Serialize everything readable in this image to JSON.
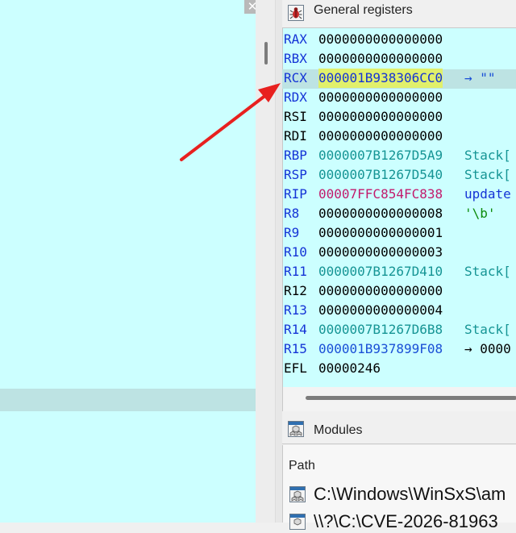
{
  "left_pane": {
    "close_glyph": "✕"
  },
  "registers_panel": {
    "title": "General registers",
    "rows": [
      {
        "name": "RAX",
        "value": "0000000000000000",
        "info": ""
      },
      {
        "name": "RBX",
        "value": "0000000000000000",
        "info": ""
      },
      {
        "name": "RCX",
        "value": "000001B938306CC0",
        "info": "→ \"\""
      },
      {
        "name": "RDX",
        "value": "0000000000000000",
        "info": ""
      },
      {
        "name": "RSI",
        "value": "0000000000000000",
        "info": ""
      },
      {
        "name": "RDI",
        "value": "0000000000000000",
        "info": ""
      },
      {
        "name": "RBP",
        "value": "0000007B1267D5A9",
        "info": "Stack["
      },
      {
        "name": "RSP",
        "value": "0000007B1267D540",
        "info": "Stack["
      },
      {
        "name": "RIP",
        "value": "00007FFC854FC838",
        "info": "update"
      },
      {
        "name": "R8",
        "value": "0000000000000008",
        "info": "'\\b'"
      },
      {
        "name": "R9",
        "value": "0000000000000001",
        "info": ""
      },
      {
        "name": "R10",
        "value": "0000000000000003",
        "info": ""
      },
      {
        "name": "R11",
        "value": "0000007B1267D410",
        "info": "Stack["
      },
      {
        "name": "R12",
        "value": "0000000000000000",
        "info": ""
      },
      {
        "name": "R13",
        "value": "0000000000000004",
        "info": ""
      },
      {
        "name": "R14",
        "value": "0000007B1267D6B8",
        "info": "Stack["
      },
      {
        "name": "R15",
        "value": "000001B937899F08",
        "info": "→ 0000"
      },
      {
        "name": "EFL",
        "value": "00000246",
        "info": ""
      }
    ]
  },
  "modules_panel": {
    "title": "Modules",
    "column_header": "Path",
    "rows": [
      {
        "path": "C:\\Windows\\WinSxS\\am"
      },
      {
        "path": "\\\\?\\C:\\CVE-2026-81963"
      }
    ]
  },
  "colors": {
    "register_changed_blue": "#1433d6",
    "stack_teal": "#159494",
    "code_pink": "#c21a6c",
    "char_green": "#0a8a0a",
    "highlight_yellow": "#e1f06b",
    "annotation_arrow_red": "#e8201f"
  },
  "icons": {
    "registers": "bug-icon",
    "modules": "modules-icon",
    "module_row": "module-file-icon"
  }
}
